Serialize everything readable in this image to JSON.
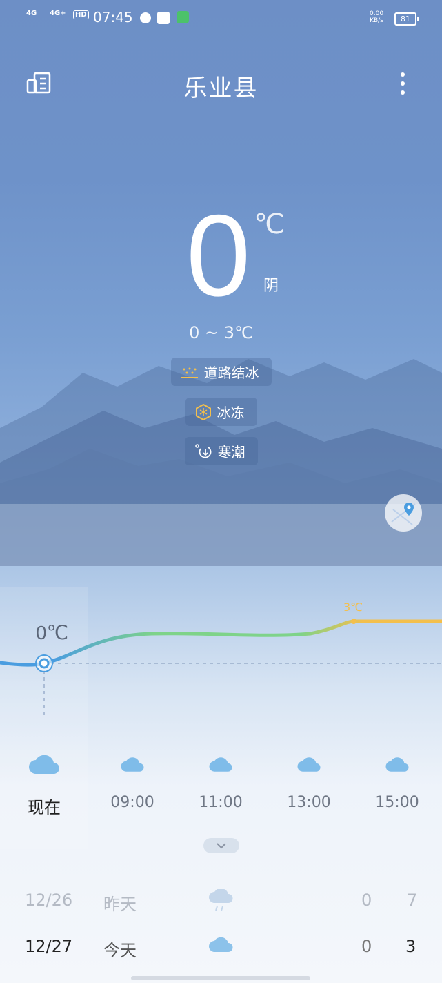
{
  "status_bar": {
    "signal1": "4G",
    "signal2": "4G+",
    "hd": "HD",
    "time": "07:45",
    "net_speed": "0.00",
    "net_unit": "KB/s",
    "battery": "81"
  },
  "header": {
    "city": "乐业县"
  },
  "current": {
    "temperature": "0",
    "unit": "℃",
    "condition": "阴",
    "range": "0 ~ 3℃"
  },
  "alerts": [
    {
      "label": "道路结冰",
      "icon": "road-ice-icon"
    },
    {
      "label": "冰冻",
      "icon": "freeze-icon"
    },
    {
      "label": "寒潮",
      "icon": "cold-wave-icon"
    }
  ],
  "hourly": {
    "now_temp_label": "0℃",
    "peak_temp_label": "3℃",
    "items": [
      {
        "time": "现在",
        "icon": "cloud-icon"
      },
      {
        "time": "09:00",
        "icon": "cloud-icon"
      },
      {
        "time": "11:00",
        "icon": "cloud-icon"
      },
      {
        "time": "13:00",
        "icon": "cloud-icon"
      },
      {
        "time": "15:00",
        "icon": "cloud-icon"
      }
    ]
  },
  "daily": [
    {
      "date": "12/26",
      "day": "昨天",
      "icon": "rain-cloud-icon",
      "low": "0",
      "high": "7"
    },
    {
      "date": "12/27",
      "day": "今天",
      "icon": "cloud-icon",
      "low": "0",
      "high": "3"
    }
  ],
  "colors": {
    "accent_orange": "#f3bf4c",
    "accent_green": "#7ed389",
    "accent_blue": "#4a9de0"
  }
}
